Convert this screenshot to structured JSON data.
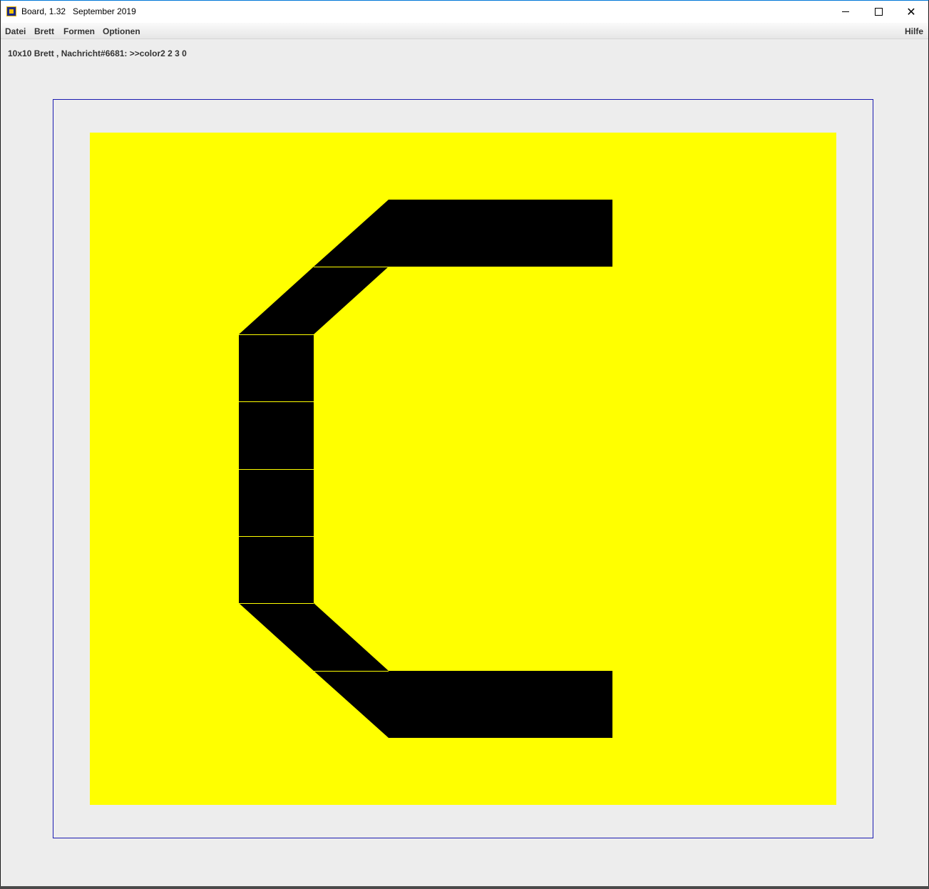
{
  "window": {
    "title": "Board, 1.32   September 2019",
    "icon": "board-app-icon",
    "controls": {
      "minimize_icon": "minimize-icon",
      "maximize_icon": "maximize-icon",
      "close_icon": "close-icon"
    }
  },
  "menu": {
    "items": [
      "Datei",
      "Brett",
      "Formen",
      "Optionen"
    ],
    "help": "Hilfe"
  },
  "status": {
    "message": "10x10 Brett , Nachricht#6681: >>color2 2 3 0"
  },
  "board": {
    "size": "10x10",
    "background_color": "#ffff00",
    "frame_color": "#1a1ab0",
    "shape_color": "#000000",
    "separator_color": "#ffff00"
  }
}
